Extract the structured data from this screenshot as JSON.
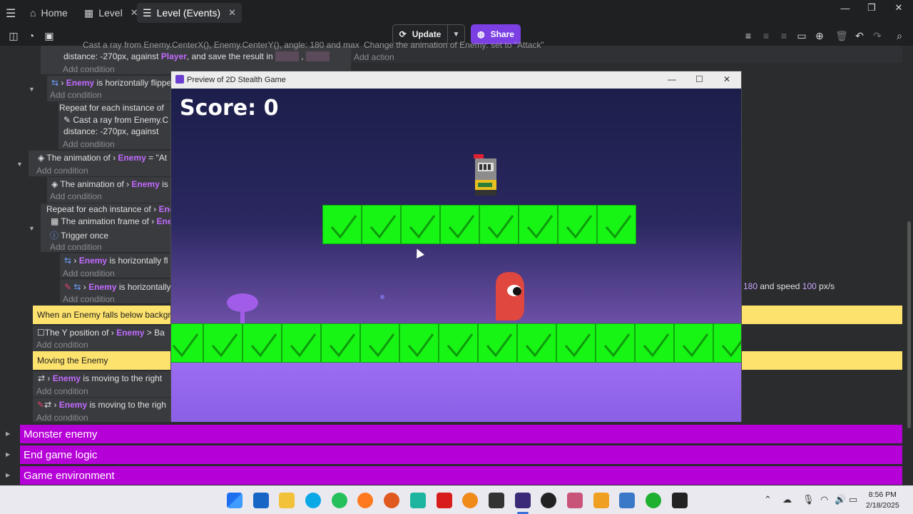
{
  "tabs": {
    "home": "Home",
    "level": "Level",
    "level_events": "Level (Events)"
  },
  "toolbar": {
    "update": "Update",
    "share": "Share"
  },
  "events": {
    "e1_line1": "Cast a ray from Enemy.CenterX(), Enemy.CenterY(), angle: 180 and max",
    "e1_dist": "distance: -270px, against",
    "e1_player": "Player",
    "e1_save": ", and save the result in",
    "add_condition": "Add condition",
    "add_action": "Add action",
    "right_change": "Change the animation of",
    "right_enemy": "Enemy",
    "right_setto": ": set to",
    "right_attack": "\"Attack\"",
    "e2_enemy": "Enemy",
    "e2_text": "is horizontally flipped",
    "repeat_each": "Repeat for each instance of",
    "e3_line1": "Cast a ray from Enemy.C",
    "e3_dist": "distance: -270px, against",
    "anim_of": "The animation of",
    "anim_enemy": "Enemy",
    "anim_eq": "= \"At",
    "anim2_enemy": "Enemy",
    "anim2_is": "is",
    "repeat2": "Repeat for each instance of",
    "repeat2_en": "Ene",
    "anim_frame": "The animation frame of",
    "anim_frame_en": "Ene",
    "trigger_once": "Trigger once",
    "flip2_enemy": "Enemy",
    "flip2_text": "is horizontally fl",
    "flip3_enemy": "Enemy",
    "flip3_text": "is horizontally",
    "speed_180": "180",
    "speed_and": "and speed",
    "speed_100": "100",
    "speed_px": "px/s",
    "falls_below": "When an Enemy falls below backgro",
    "ypos": "The Y position of",
    "ypos_enemy": "Enemy",
    "ypos_gt": "> Ba",
    "moving": "Moving the Enemy",
    "mv1_enemy": "Enemy",
    "mv1_text": "is moving to the right",
    "mv2_enemy": "Enemy",
    "mv2_text": "is moving to the righ"
  },
  "groups": [
    "Monster enemy",
    "End game logic",
    "Game environment"
  ],
  "preview": {
    "title": "Preview of 2D Stealth Game",
    "score": "Score: 0"
  },
  "clock": {
    "time": "8:56 PM",
    "date": "2/18/2025"
  },
  "colors": {
    "accent": "#7b3fe4",
    "group": "#b600d8",
    "comment": "#fde26e",
    "tile": "#17f514"
  }
}
